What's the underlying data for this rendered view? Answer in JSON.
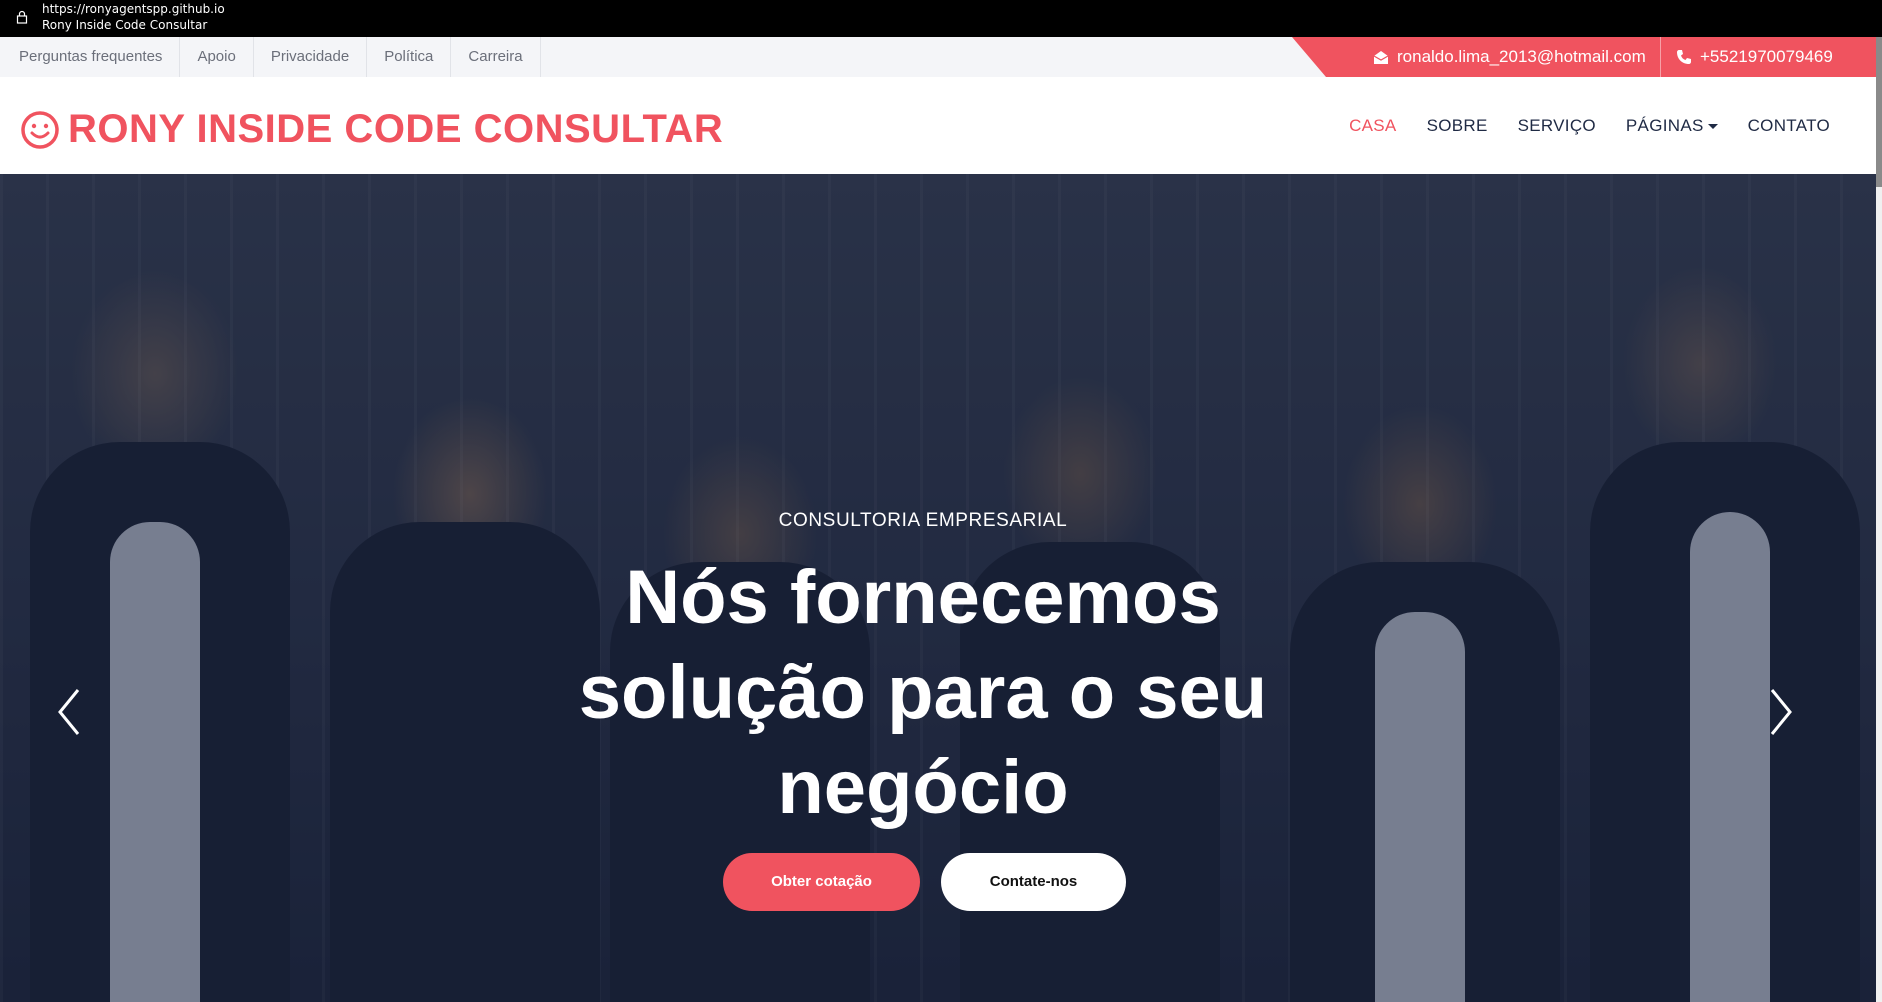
{
  "browser": {
    "url": "https://ronyagentspp.github.io",
    "page_title": "Rony Inside Code Consultar"
  },
  "topbar": {
    "links": [
      "Perguntas frequentes",
      "Apoio",
      "Privacidade",
      "Política",
      "Carreira"
    ],
    "email": "ronaldo.lima_2013@hotmail.com",
    "phone": "+5521970079469"
  },
  "navbar": {
    "brand": "RONY INSIDE CODE CONSULTAR",
    "menu": [
      "CASA",
      "SOBRE",
      "SERVIÇO",
      "PÁGINAS",
      "CONTATO"
    ],
    "active": "CASA"
  },
  "hero": {
    "subtitle": "CONSULTORIA EMPRESARIAL",
    "title": "Nós fornecemos solução para o seu negócio",
    "buttons": {
      "quote": "Obter cotação",
      "contact": "Contate-nos"
    }
  },
  "colors": {
    "accent": "#f0535f",
    "dark": "#1f2a44"
  }
}
